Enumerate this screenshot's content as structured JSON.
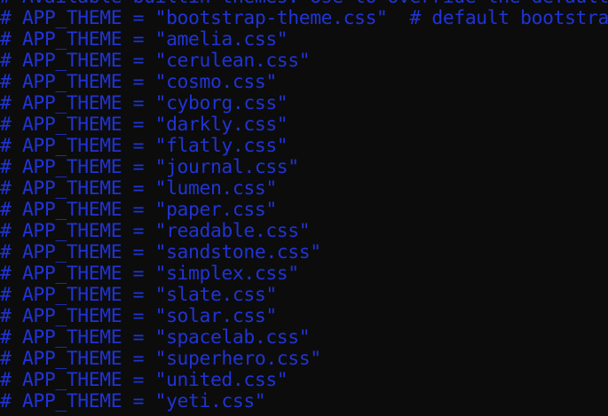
{
  "terminal": {
    "lines": [
      "# Available builtin themes. Use to override the default theme",
      "# APP_THEME = \"bootstrap-theme.css\"  # default bootstrap",
      "# APP_THEME = \"amelia.css\"",
      "# APP_THEME = \"cerulean.css\"",
      "# APP_THEME = \"cosmo.css\"",
      "# APP_THEME = \"cyborg.css\"",
      "# APP_THEME = \"darkly.css\"",
      "# APP_THEME = \"flatly.css\"",
      "# APP_THEME = \"journal.css\"",
      "# APP_THEME = \"lumen.css\"",
      "# APP_THEME = \"paper.css\"",
      "# APP_THEME = \"readable.css\"",
      "# APP_THEME = \"sandstone.css\"",
      "# APP_THEME = \"simplex.css\"",
      "# APP_THEME = \"slate.css\"",
      "# APP_THEME = \"solar.css\"",
      "# APP_THEME = \"spacelab.css\"",
      "# APP_THEME = \"superhero.css\"",
      "# APP_THEME = \"united.css\"",
      "# APP_THEME = \"yeti.css\""
    ],
    "text_color": "#2034d6",
    "background_color": "#0c0c0c"
  }
}
